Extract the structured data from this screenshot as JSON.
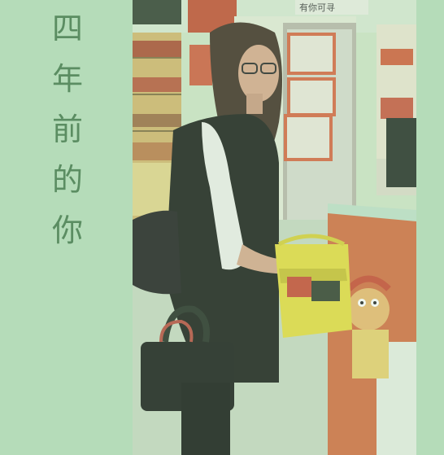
{
  "title": {
    "chars": [
      "四",
      "年",
      "前",
      "的",
      "你"
    ]
  },
  "photo": {
    "scene": "photo",
    "sign_text": "有你可寻"
  },
  "colors": {
    "background": "#b5dcb9",
    "title_text": "#5b8d62"
  }
}
